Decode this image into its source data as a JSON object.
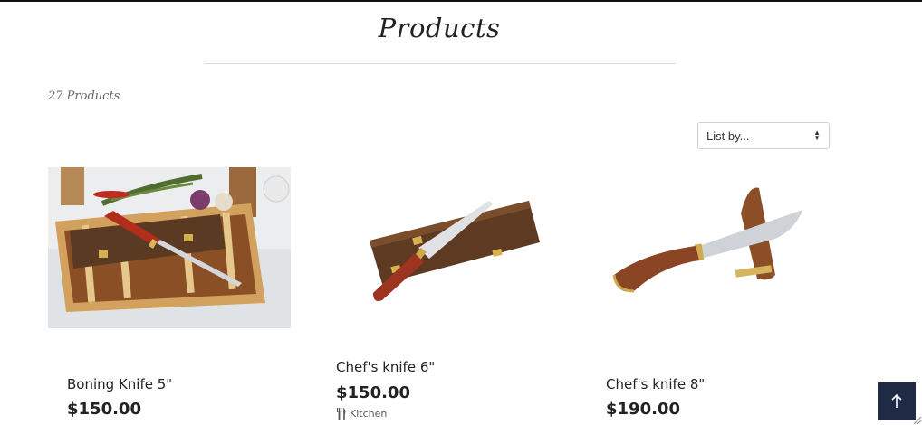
{
  "page": {
    "title": "Products",
    "product_count": "27 Products"
  },
  "sort": {
    "label": "List by..."
  },
  "products": [
    {
      "name": "Boning Knife 5\"",
      "price": "$150.00",
      "tag": ""
    },
    {
      "name": "Chef's knife 6\"",
      "price": "$150.00",
      "tag": "Kitchen"
    },
    {
      "name": "Chef's knife 8\"",
      "price": "$190.00",
      "tag": ""
    }
  ],
  "icons": {
    "sort": "sort-arrows-icon",
    "tag": "fork-knife-icon",
    "back_to_top": "arrow-up-icon"
  },
  "colors": {
    "accent": "#1f2a44",
    "text": "#222222",
    "muted": "#666666"
  }
}
